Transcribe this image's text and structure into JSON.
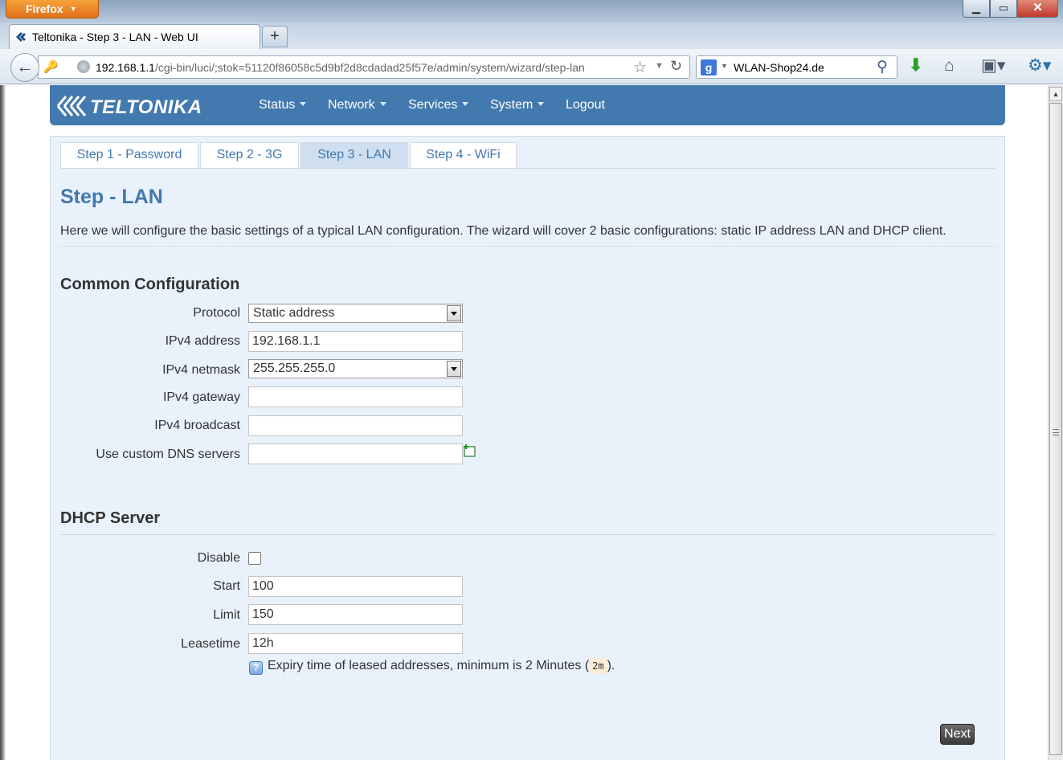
{
  "browser": {
    "app_button": "Firefox",
    "tab_title": "Teltonika - Step 3 - LAN - Web UI",
    "url_host": "192.168.1.1",
    "url_path": "/cgi-bin/luci/;stok=51120f86058c5d9bf2d8cdadad25f57e/admin/system/wizard/step-lan",
    "search_value": "WLAN-Shop24.de",
    "search_engine_letter": "g"
  },
  "header": {
    "logo_text": "TELTONIKA",
    "menu": [
      {
        "label": "Status"
      },
      {
        "label": "Network"
      },
      {
        "label": "Services"
      },
      {
        "label": "System"
      },
      {
        "label": "Logout"
      }
    ]
  },
  "wizard": {
    "tabs": [
      {
        "label": "Step 1 - Password"
      },
      {
        "label": "Step 2 - 3G"
      },
      {
        "label": "Step 3 - LAN",
        "active": true
      },
      {
        "label": "Step 4 - WiFi"
      }
    ]
  },
  "page": {
    "title": "Step - LAN",
    "description": "Here we will configure the basic settings of a typical LAN configuration. The wizard will cover 2 basic configurations: static IP address LAN and DHCP client."
  },
  "common": {
    "title": "Common Configuration",
    "protocol": {
      "label": "Protocol",
      "value": "Static address"
    },
    "ipv4_address": {
      "label": "IPv4 address",
      "value": "192.168.1.1"
    },
    "ipv4_netmask": {
      "label": "IPv4 netmask",
      "value": "255.255.255.0"
    },
    "ipv4_gateway": {
      "label": "IPv4 gateway",
      "value": ""
    },
    "ipv4_broadcast": {
      "label": "IPv4 broadcast",
      "value": ""
    },
    "dns": {
      "label": "Use custom DNS servers",
      "value": ""
    }
  },
  "dhcp": {
    "title": "DHCP Server",
    "disable": {
      "label": "Disable",
      "checked": false
    },
    "start": {
      "label": "Start",
      "value": "100"
    },
    "limit": {
      "label": "Limit",
      "value": "150"
    },
    "leasetime": {
      "label": "Leasetime",
      "value": "12h"
    },
    "hint_prefix": "Expiry time of leased addresses, minimum is 2 Minutes (",
    "hint_code": "2m",
    "hint_suffix": ")."
  },
  "actions": {
    "next_label": "Next"
  },
  "colors": {
    "header_bg": "#4279ae",
    "content_bg": "#e9f1fb",
    "link": "#4279ae"
  }
}
